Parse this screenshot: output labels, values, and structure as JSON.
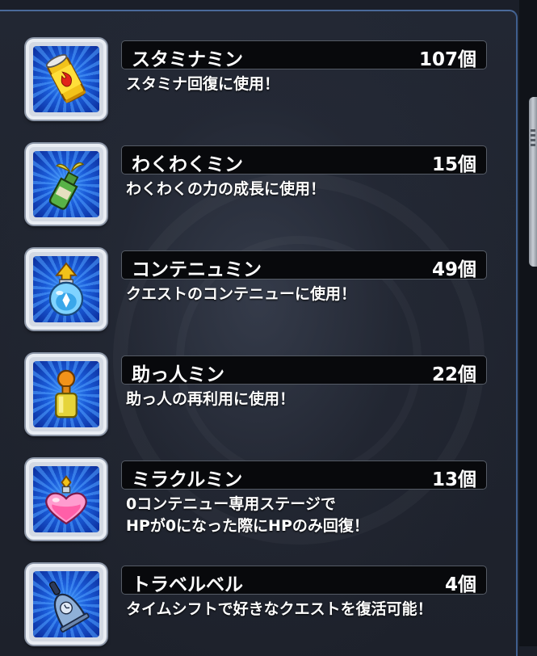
{
  "items": [
    {
      "name": "スタミナミン",
      "count": "107個",
      "description": "スタミナ回復に使用！",
      "icon": "stamina-can-icon"
    },
    {
      "name": "わくわくミン",
      "count": "15個",
      "description": "わくわくの力の成長に使用！",
      "icon": "sprout-bottle-icon"
    },
    {
      "name": "コンテニュミン",
      "count": "49個",
      "description": "クエストのコンテニューに使用！",
      "icon": "continue-flask-icon"
    },
    {
      "name": "助っ人ミン",
      "count": "22個",
      "description": "助っ人の再利用に使用！",
      "icon": "helper-bottle-icon"
    },
    {
      "name": "ミラクルミン",
      "count": "13個",
      "description": "0コンテニュー専用ステージで\nHPが0になった際にHPのみ回復！",
      "icon": "heart-potion-icon"
    },
    {
      "name": "トラベルベル",
      "count": "4個",
      "description": "タイムシフトで好きなクエストを復活可能！",
      "icon": "travel-bell-icon"
    }
  ],
  "colors": {
    "name_bar_bg": "#08090c",
    "icon_bg": "#1a5bd8",
    "frame_border": "#4a6a9a"
  }
}
